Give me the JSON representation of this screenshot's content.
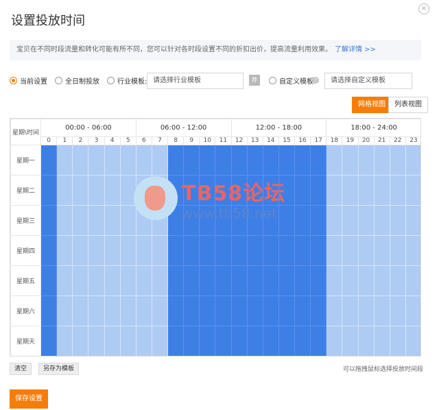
{
  "dialog": {
    "title": "设置投放时间",
    "close_symbol": "×"
  },
  "notice": {
    "text": "宝贝在不同时段流量和转化可能有所不同，您可以针对各时段设置不同的折扣出价，提高流量利用效果。",
    "link_label": "了解详情 >>"
  },
  "options": {
    "current": "当前设置",
    "all_day": "全日制投放",
    "industry_label": "行业模板:",
    "industry_placeholder": "请选择行业模板",
    "industry_tag": "荐",
    "custom_label": "自定义模板:",
    "help_symbol": "?",
    "custom_placeholder": "请选择自定义模板",
    "selected": "current"
  },
  "view_toggle": {
    "grid": "网格视图",
    "list": "列表视图",
    "active": "grid"
  },
  "grid": {
    "corner": "星期\\时间",
    "periods": [
      "00:00 - 06:00",
      "06:00 - 12:00",
      "12:00 - 18:00",
      "18:00 - 24:00"
    ],
    "hours": [
      "0",
      "1",
      "2",
      "3",
      "4",
      "5",
      "6",
      "7",
      "8",
      "9",
      "10",
      "11",
      "12",
      "13",
      "14",
      "15",
      "16",
      "17",
      "18",
      "19",
      "20",
      "21",
      "22",
      "23"
    ],
    "days": [
      "星期一",
      "星期二",
      "星期三",
      "星期四",
      "星期五",
      "星期六",
      "星期天"
    ],
    "active_hours": [
      0,
      8,
      9,
      10,
      11,
      12,
      13,
      14,
      15,
      16,
      17
    ],
    "colors": {
      "active": "#3e7fe6",
      "inactive": "#aecbf4"
    }
  },
  "watermark": {
    "brand": "TB58论坛",
    "url": "www.tb58.net"
  },
  "footer": {
    "clear": "清空",
    "save_template": "另存为模板",
    "hint": "可以拖拽鼠标选择投放时间段",
    "save": "保存设置"
  }
}
